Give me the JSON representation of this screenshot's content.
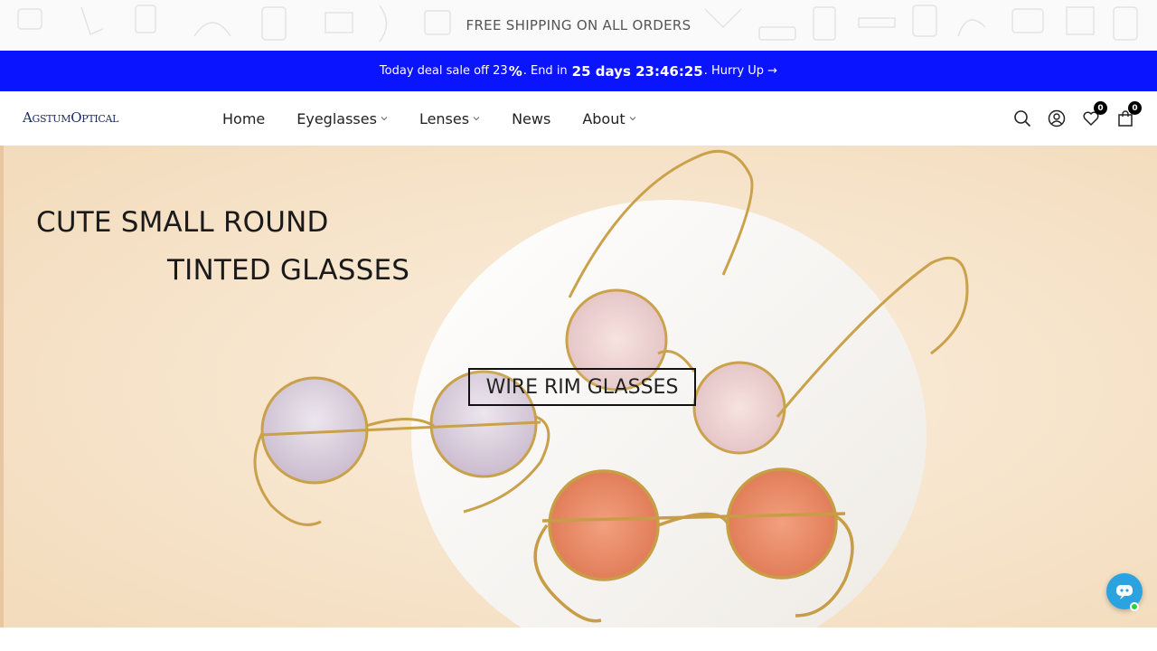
{
  "announcement": {
    "text": "FREE SHIPPING ON ALL ORDERS"
  },
  "deal": {
    "prefix": "Today deal sale off 23",
    "percent": "%",
    "end_label": ". End in",
    "days": "25 days 23:46:25",
    "hurry": ". Hurry Up →"
  },
  "header": {
    "logo": "AgstumOptical",
    "nav": [
      {
        "label": "Home",
        "has_dropdown": false
      },
      {
        "label": "Eyeglasses",
        "has_dropdown": true
      },
      {
        "label": "Lenses",
        "has_dropdown": true
      },
      {
        "label": "News",
        "has_dropdown": false
      },
      {
        "label": "About",
        "has_dropdown": true
      }
    ],
    "icons": {
      "search": "search-icon",
      "account": "user-icon",
      "wishlist": "heart-icon",
      "cart": "bag-icon"
    },
    "wishlist_count": "0",
    "cart_count": "0"
  },
  "hero": {
    "line1": "CUTE SMALL ROUND",
    "line2": "TINTED GLASSES",
    "cta": "WIRE RIM GLASSES"
  },
  "colors": {
    "deal_bar": "#0a14ff",
    "hero_bg": "#f8e7d0",
    "chat_button": "#2aa3e0"
  }
}
